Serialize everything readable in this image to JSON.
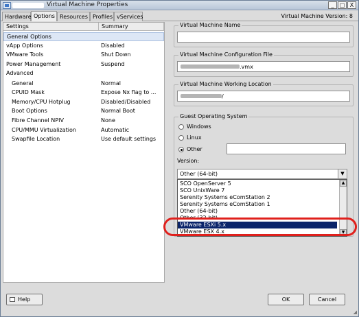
{
  "window": {
    "title": "Virtual Machine Properties",
    "version_label": "Virtual Machine Version: 8",
    "controls": [
      "_",
      "□",
      "X"
    ]
  },
  "tabs": [
    {
      "label": "Hardware"
    },
    {
      "label": "Options"
    },
    {
      "label": "Resources"
    },
    {
      "label": "Profiles"
    },
    {
      "label": "vServices"
    }
  ],
  "settings": {
    "col_settings": "Settings",
    "col_summary": "Summary",
    "rows": [
      {
        "name": "General Options",
        "summary": ""
      },
      {
        "name": "vApp Options",
        "summary": "Disabled"
      },
      {
        "name": "VMware Tools",
        "summary": "Shut Down"
      },
      {
        "name": "Power Management",
        "summary": "Suspend"
      },
      {
        "name": "Advanced",
        "summary": ""
      },
      {
        "name": "General",
        "summary": "Normal"
      },
      {
        "name": "CPUID Mask",
        "summary": "Expose Nx flag to ..."
      },
      {
        "name": "Memory/CPU Hotplug",
        "summary": "Disabled/Disabled"
      },
      {
        "name": "Boot Options",
        "summary": "Normal Boot"
      },
      {
        "name": "Fibre Channel NPIV",
        "summary": "None"
      },
      {
        "name": "CPU/MMU Virtualization",
        "summary": "Automatic"
      },
      {
        "name": "Swapfile Location",
        "summary": "Use default settings"
      }
    ]
  },
  "vm_name": {
    "label": "Virtual Machine Name",
    "value": ""
  },
  "config_file": {
    "label": "Virtual Machine Configuration File",
    "value_suffix": ".vmx"
  },
  "working_location": {
    "label": "Virtual Machine Working Location",
    "value_suffix": "/"
  },
  "guest_os": {
    "label": "Guest Operating System",
    "options": [
      "Windows",
      "Linux",
      "Other"
    ],
    "selected": "Other",
    "other_value": "",
    "version_label": "Version:",
    "version_selected": "Other (64-bit)",
    "dropdown_items": [
      "SCO OpenServer 5",
      "SCO UnixWare 7",
      "Serenity Systems eComStation 2",
      "Serenity Systems eComStation 1",
      "Other (64-bit)",
      "Other (32-bit)",
      "VMware ESXi 5.x",
      "VMware ESX 4.x"
    ],
    "highlighted_item": "VMware ESXi 5.x"
  },
  "buttons": {
    "help": "Help",
    "ok": "OK",
    "cancel": "Cancel"
  },
  "colors": {
    "highlight": "#0a246a",
    "annotation": "#e0201c",
    "selection": "#dde7f6"
  }
}
